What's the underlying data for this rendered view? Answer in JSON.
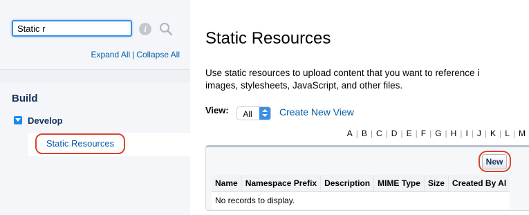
{
  "sidebar": {
    "search": {
      "value": "Static r"
    },
    "expand_all": "Expand All",
    "collapse_all": "Collapse All",
    "separator": "|",
    "section_title": "Build",
    "group_label": "Develop",
    "selected_item": "Static Resources"
  },
  "main": {
    "title": "Static Resources",
    "description_line1": "Use static resources to upload content that you want to reference i",
    "description_line2": "images, stylesheets, JavaScript, and other files.",
    "view_label": "View:",
    "view_selected": "All",
    "create_view_link": "Create New View",
    "alphabet": [
      "A",
      "B",
      "C",
      "D",
      "E",
      "F",
      "G",
      "H",
      "I",
      "J",
      "K",
      "L",
      "M"
    ],
    "new_button": "New",
    "table": {
      "columns": [
        "Name",
        "Namespace Prefix",
        "Description",
        "MIME Type",
        "Size",
        "Created By Al"
      ],
      "empty_message": "No records to display."
    }
  },
  "colors": {
    "link": "#015ba7",
    "highlight_circle": "#d9442a",
    "focus_border": "#3b8ee8"
  }
}
